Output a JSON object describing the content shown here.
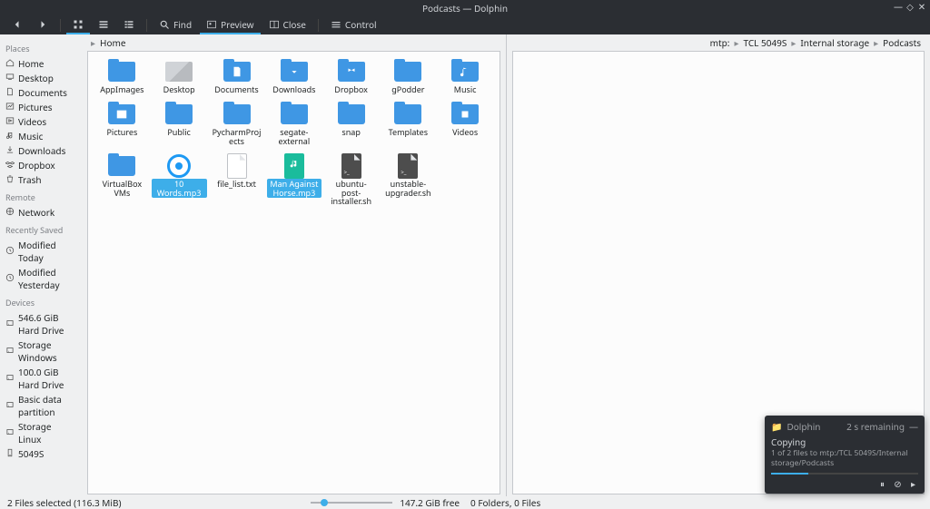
{
  "window": {
    "title": "Podcasts — Dolphin",
    "min_tip": "Minimize",
    "max_tip": "Maximize",
    "close_tip": "Close"
  },
  "toolbar": {
    "back": "Back",
    "forward": "Forward",
    "icon_view": "Icons",
    "compact_view": "Compact",
    "details_view": "Details",
    "find": "Find",
    "preview": "Preview",
    "close": "Close",
    "control": "Control"
  },
  "sidebar": {
    "places_hdr": "Places",
    "places": [
      {
        "label": "Home",
        "icon": "home"
      },
      {
        "label": "Desktop",
        "icon": "desktop"
      },
      {
        "label": "Documents",
        "icon": "documents"
      },
      {
        "label": "Pictures",
        "icon": "pictures"
      },
      {
        "label": "Videos",
        "icon": "videos"
      },
      {
        "label": "Music",
        "icon": "music"
      },
      {
        "label": "Downloads",
        "icon": "downloads"
      },
      {
        "label": "Dropbox",
        "icon": "dropbox"
      },
      {
        "label": "Trash",
        "icon": "trash"
      }
    ],
    "remote_hdr": "Remote",
    "remote": [
      {
        "label": "Network",
        "icon": "network"
      }
    ],
    "recent_hdr": "Recently Saved",
    "recent": [
      {
        "label": "Modified Today",
        "icon": "clock"
      },
      {
        "label": "Modified Yesterday",
        "icon": "clock"
      }
    ],
    "devices_hdr": "Devices",
    "devices": [
      {
        "label": "546.6 GiB Hard Drive",
        "icon": "drive"
      },
      {
        "label": "Storage Windows",
        "icon": "drive"
      },
      {
        "label": "100.0 GiB Hard Drive",
        "icon": "drive"
      },
      {
        "label": "Basic data partition",
        "icon": "drive"
      },
      {
        "label": "Storage Linux",
        "icon": "drive"
      },
      {
        "label": "5049S",
        "icon": "phone"
      }
    ]
  },
  "left_pane": {
    "breadcrumb": [
      "Home"
    ],
    "items": [
      {
        "label": "AppImages",
        "kind": "folder"
      },
      {
        "label": "Desktop",
        "kind": "thumb"
      },
      {
        "label": "Documents",
        "kind": "folder-docs"
      },
      {
        "label": "Downloads",
        "kind": "folder-dl"
      },
      {
        "label": "Dropbox",
        "kind": "folder-db"
      },
      {
        "label": "gPodder",
        "kind": "folder"
      },
      {
        "label": "Music",
        "kind": "folder-music"
      },
      {
        "label": "Pictures",
        "kind": "folder-pic"
      },
      {
        "label": "Public",
        "kind": "folder"
      },
      {
        "label": "PycharmProjects",
        "kind": "folder"
      },
      {
        "label": "segate-external",
        "kind": "folder"
      },
      {
        "label": "snap",
        "kind": "folder"
      },
      {
        "label": "Templates",
        "kind": "folder"
      },
      {
        "label": "Videos",
        "kind": "folder-vid"
      },
      {
        "label": "VirtualBox VMs",
        "kind": "folder"
      },
      {
        "label": "10 Words.mp3",
        "kind": "audio-app",
        "selected": true
      },
      {
        "label": "file_list.txt",
        "kind": "txt"
      },
      {
        "label": "Man Against Horse.mp3",
        "kind": "audio",
        "selected": true
      },
      {
        "label": "ubuntu-post-installer.sh",
        "kind": "sh"
      },
      {
        "label": "unstable-upgrader.sh",
        "kind": "sh"
      }
    ],
    "status": "2 Files selected (116.3 MiB)",
    "free_space": "147.2 GiB free"
  },
  "right_pane": {
    "breadcrumb": [
      "mtp:",
      "TCL 5049S",
      "Internal storage",
      "Podcasts"
    ],
    "status": "0 Folders, 0 Files"
  },
  "notification": {
    "app": "Dolphin",
    "remaining": "2 s remaining",
    "title": "Copying",
    "detail": "1 of 2 files to mtp:/TCL 5049S/Internal storage/Podcasts"
  }
}
